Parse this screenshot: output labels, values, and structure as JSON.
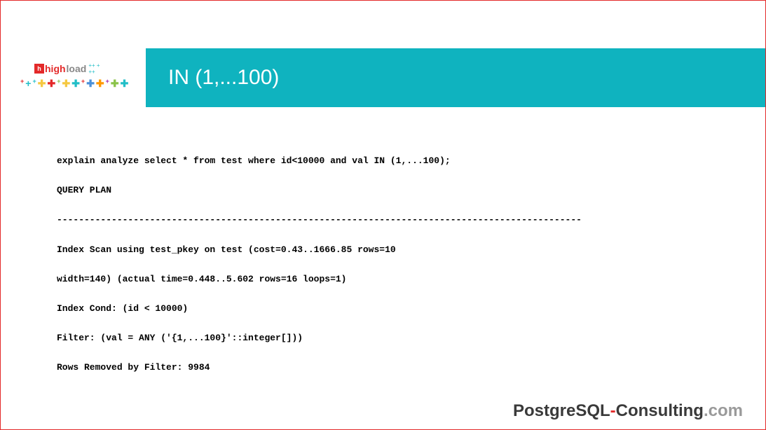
{
  "header": {
    "logo": {
      "high": "high",
      "load": "load"
    },
    "title": "IN (1,...100)"
  },
  "content": {
    "line1": "explain analyze select * from test where id<10000 and val IN (1,...100);",
    "line2": "QUERY PLAN",
    "line3": "------------------------------------------------------------------------------------------------",
    "line4": "Index Scan using test_pkey on test  (cost=0.43..1666.85 rows=10",
    "line5": "width=140) (actual time=0.448..5.602 rows=16 loops=1)",
    "line6": " Index Cond: (id < 10000)",
    "line7": " Filter: (val = ANY ('{1,...100}'::integer[]))",
    "line8": " Rows Removed by Filter: 9984"
  },
  "footer": {
    "postgre": "Postgre",
    "sql": "SQL",
    "dash": "-",
    "consulting": "Consulting",
    "dot": ".",
    "com": "com"
  }
}
